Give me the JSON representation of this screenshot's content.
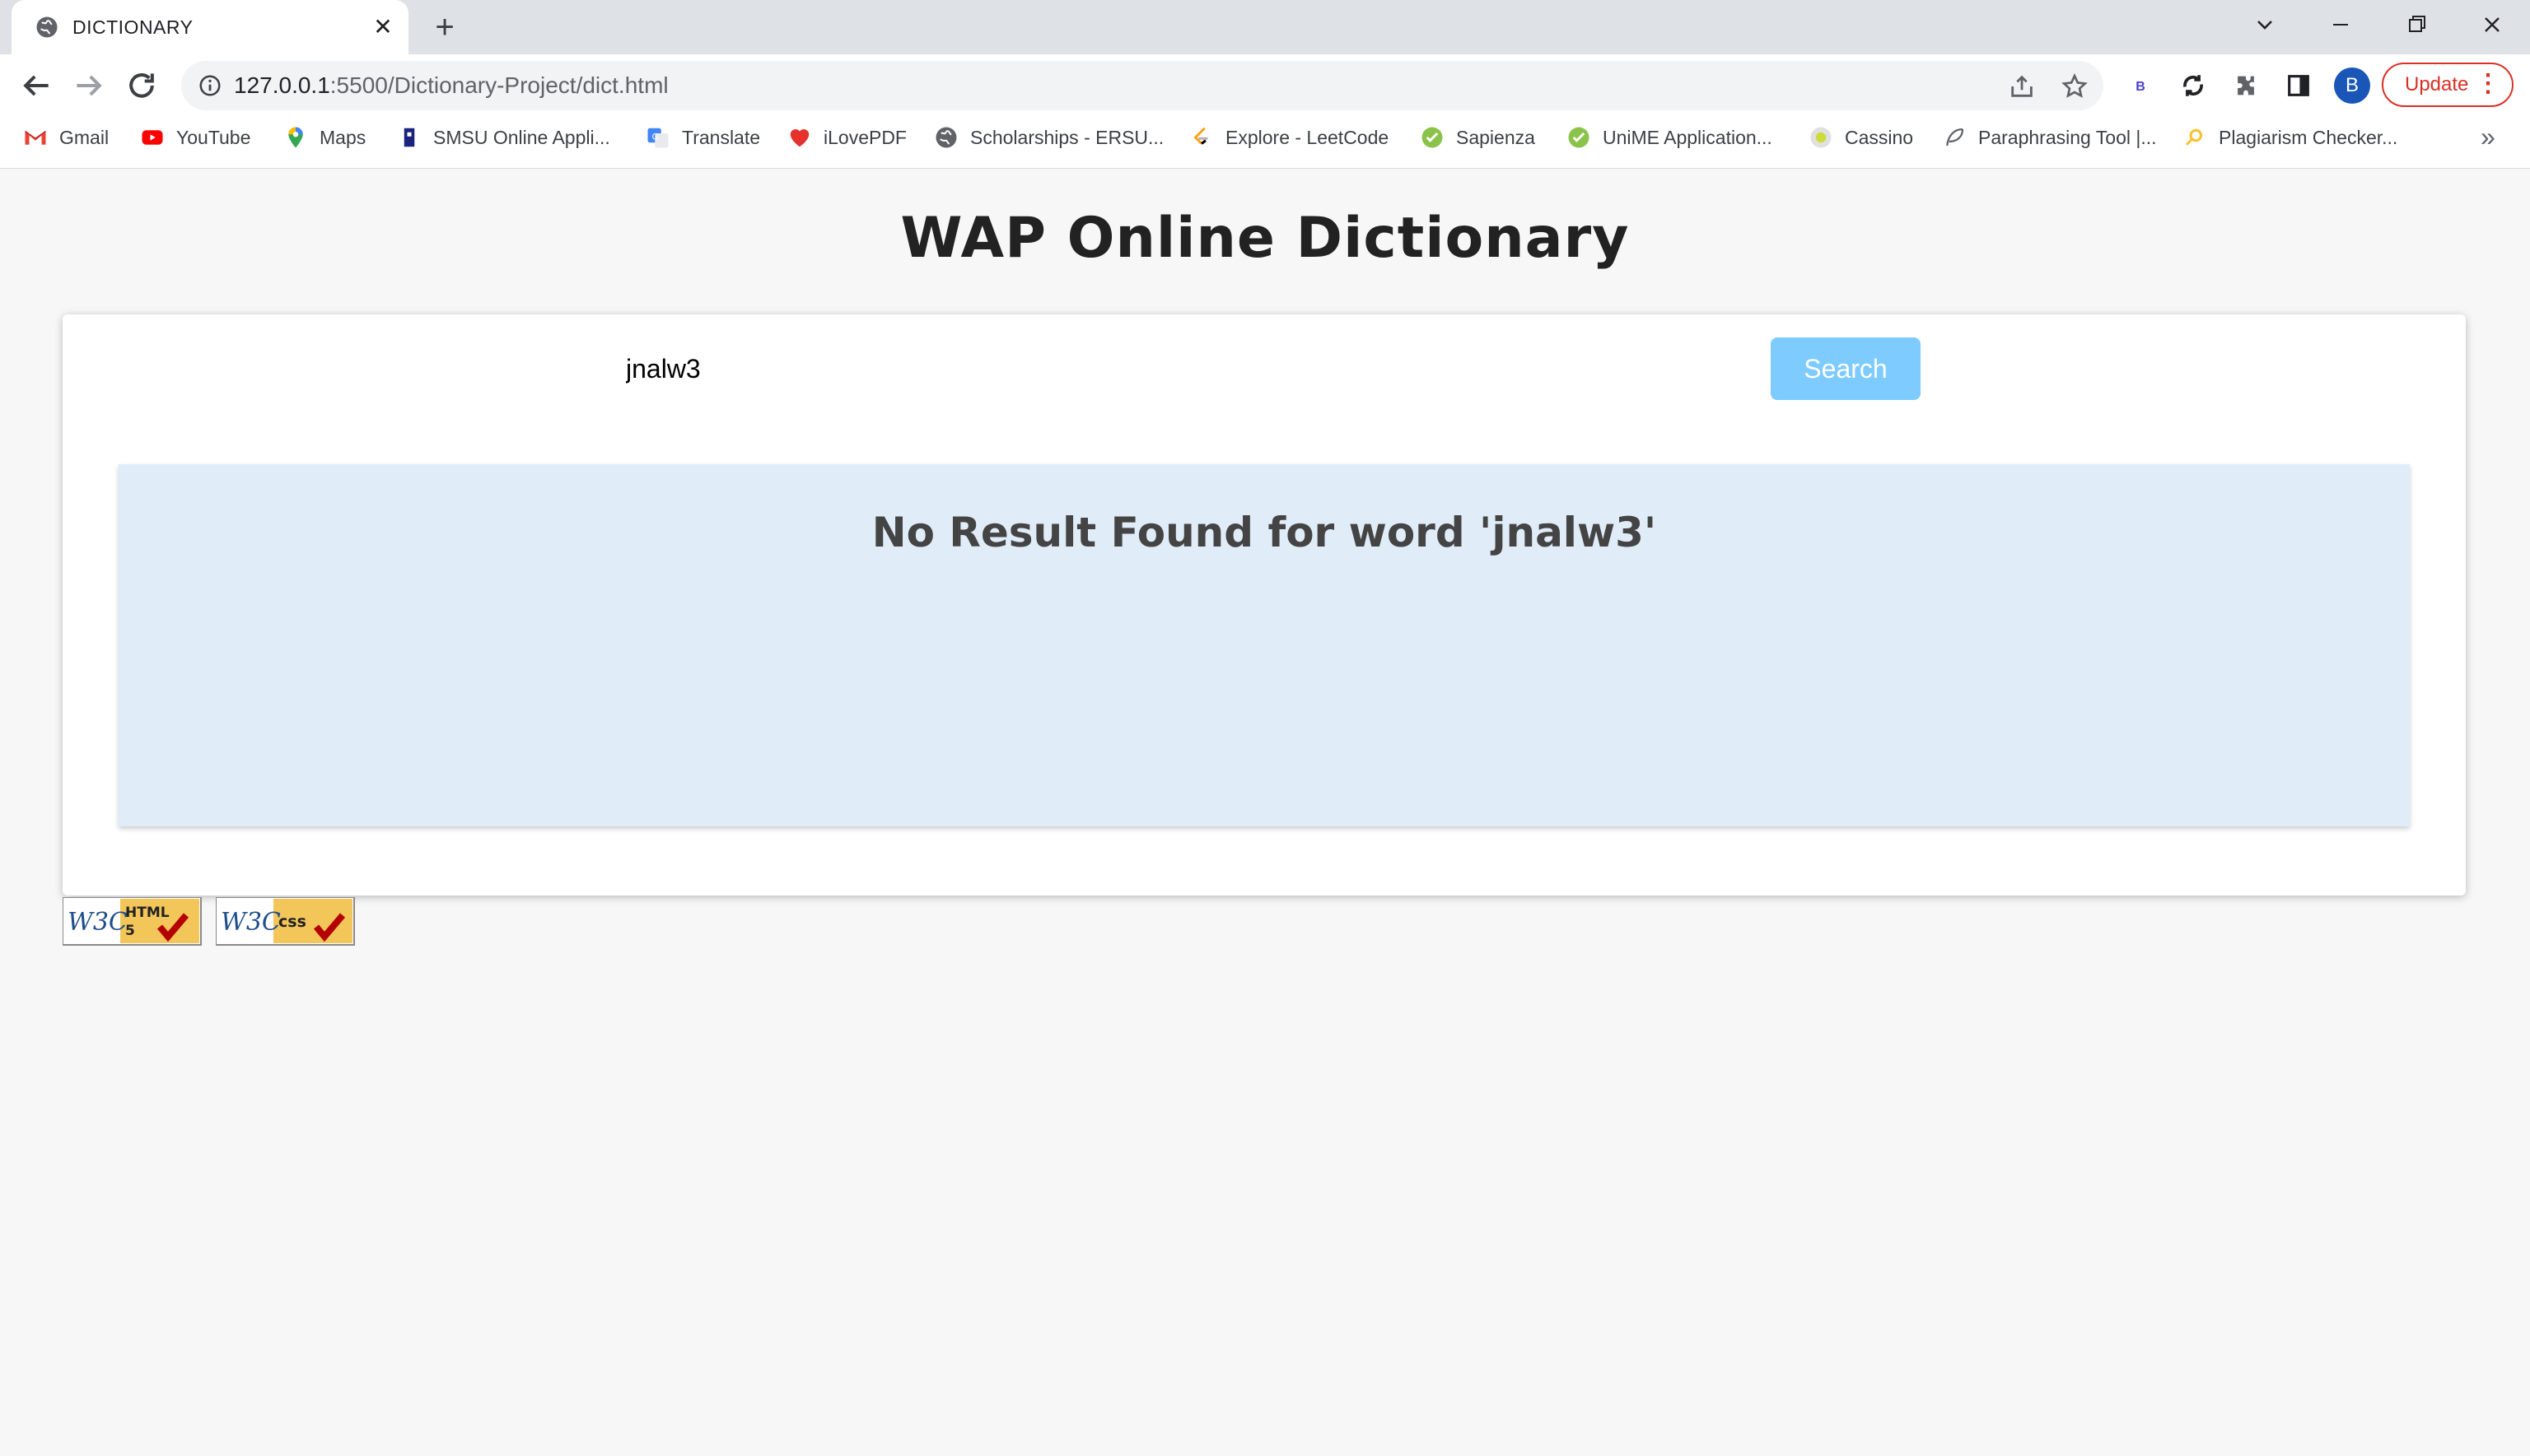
{
  "browser": {
    "tab": {
      "title": "DICTIONARY",
      "close": "✕"
    },
    "new_tab": "+",
    "window_controls": {
      "minimize": "—",
      "restore": "❐",
      "close": "✕",
      "dropdown": "⌄"
    },
    "url": {
      "host": "127.0.0.1",
      "rest": ":5500/Dictionary-Project/dict.html"
    },
    "extension_label": "B",
    "profile_initial": "B",
    "update_label": "Update",
    "bookmarks": [
      {
        "label": "Gmail",
        "icon": "gmail-icon"
      },
      {
        "label": "YouTube",
        "icon": "youtube-icon"
      },
      {
        "label": "Maps",
        "icon": "maps-icon"
      },
      {
        "label": "SMSU Online Appli...",
        "icon": "smsu-icon"
      },
      {
        "label": "Translate",
        "icon": "translate-icon"
      },
      {
        "label": "iLovePDF",
        "icon": "ilovepdf-icon"
      },
      {
        "label": "Scholarships - ERSU...",
        "icon": "globe-icon"
      },
      {
        "label": "Explore - LeetCode",
        "icon": "leetcode-icon"
      },
      {
        "label": "Sapienza",
        "icon": "check-circle-icon"
      },
      {
        "label": "UniME Application...",
        "icon": "check-circle-icon"
      },
      {
        "label": "Cassino",
        "icon": "cassino-icon"
      },
      {
        "label": "Paraphrasing Tool |...",
        "icon": "feather-icon"
      },
      {
        "label": "Plagiarism Checker...",
        "icon": "magnifier-icon"
      }
    ],
    "bookmarks_overflow": "»"
  },
  "page": {
    "heading": "WAP Online Dictionary",
    "search": {
      "value": "jnalw3",
      "button_label": "Search"
    },
    "result_message": "No Result Found for word 'jnalw3'",
    "badges": {
      "html5": "W3C HTML 5",
      "css": "W3C CSS"
    }
  },
  "colors": {
    "search_button": "#7ecbff",
    "result_background": "#e0edf8",
    "page_background": "#f7f7f7",
    "update_red": "#d93025"
  }
}
